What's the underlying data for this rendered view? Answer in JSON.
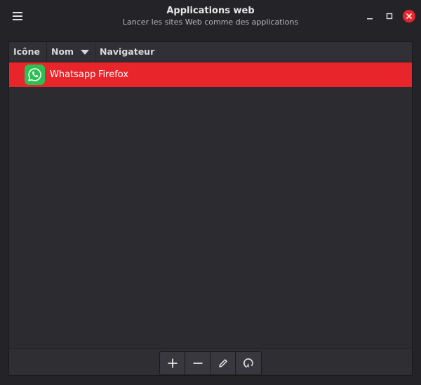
{
  "window": {
    "title": "Applications web",
    "subtitle": "Lancer les sites Web comme des applications"
  },
  "icons": {
    "menu": "hamburger-menu-icon",
    "minimize": "minimize-icon",
    "maximize": "maximize-icon",
    "close": "close-icon",
    "add": "plus-icon",
    "remove": "minus-icon",
    "edit": "pencil-icon",
    "launch": "run-icon"
  },
  "colors": {
    "accent": "#e8252b",
    "whatsapp": "#2cbf52"
  },
  "table": {
    "columns": [
      "Icône",
      "Nom",
      "Navigateur"
    ],
    "sort_column": "Nom",
    "rows": [
      {
        "name": "Whatsapp",
        "browser": "Firefox",
        "icon": "whatsapp-icon",
        "selected": true
      }
    ]
  }
}
